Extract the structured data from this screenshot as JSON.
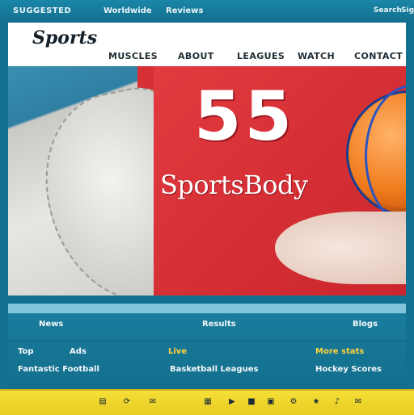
{
  "topbar": {
    "left": "SUGGESTED",
    "mid1": "Worldwide",
    "mid2": "Reviews",
    "right": "Search",
    "corner": "Sign"
  },
  "header": {
    "logo": "Sports",
    "nav": [
      "MUSCLES",
      "ABOUT",
      "LEAGUES",
      "WATCH",
      "CONTACT"
    ]
  },
  "hero": {
    "big_number": "55",
    "tagline": "SportsBody"
  },
  "panel": {
    "tabs": [
      "News",
      "Results",
      "Blogs"
    ],
    "row1": [
      "Top",
      "Ads",
      "Live",
      "More stats"
    ],
    "row2": [
      "Fantastic Football",
      "Basketball Leagues",
      "Hockey Scores"
    ]
  },
  "toolbar": {
    "icons": [
      "folder-icon",
      "refresh-icon",
      "mail-icon",
      "note-icon",
      "play-icon",
      "stop-icon",
      "image-icon",
      "settings-icon",
      "star-icon",
      "music-icon",
      "mail-icon"
    ],
    "glyphs": [
      "▤",
      "⟳",
      "✉",
      "▦",
      "▶",
      "■",
      "▣",
      "⚙",
      "★",
      "♪",
      "✉"
    ]
  },
  "colors": {
    "accent": "#13718f",
    "hero_red": "#d62f36",
    "toolbar_yellow": "#f1d52c"
  }
}
